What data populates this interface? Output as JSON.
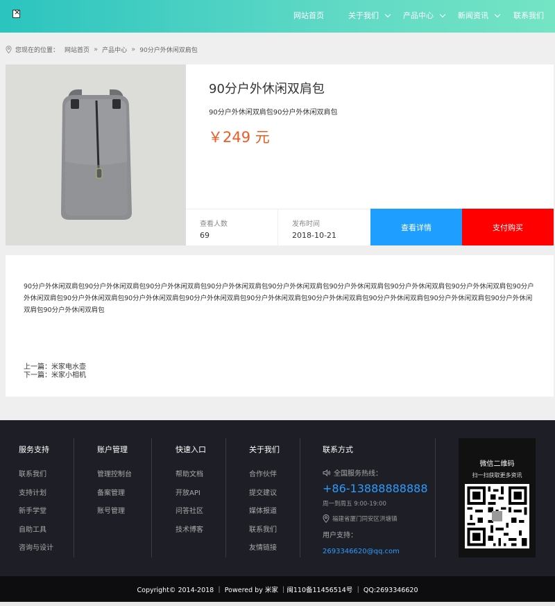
{
  "nav": {
    "items": [
      {
        "label": "网站首页",
        "dropdown": false
      },
      {
        "label": "关于我们",
        "dropdown": true
      },
      {
        "label": "产品中心",
        "dropdown": true
      },
      {
        "label": "新闻资讯",
        "dropdown": true
      },
      {
        "label": "联系我们",
        "dropdown": false
      }
    ]
  },
  "breadcrumb": {
    "prefix": "您现在的位置：",
    "items": [
      "网站首页",
      "产品中心",
      "90分户外休闲双肩包"
    ]
  },
  "product": {
    "title": "90分户外休闲双肩包",
    "subtitle": "90分户外休闲双肩包90分户外休闲双肩包",
    "price": "￥249 元",
    "views_label": "查看人数",
    "views_value": "69",
    "date_label": "发布时间",
    "date_value": "2018-10-21",
    "detail_button": "查看详情",
    "buy_button": "支付购买"
  },
  "description": {
    "text": "90分户外休闲双肩包90分户外休闲双肩包90分户外休闲双肩包90分户外休闲双肩包90分户外休闲双肩包90分户外休闲双肩包90分户外休闲双肩包90分户外休闲双肩包90分户外休闲双肩包90分户外休闲双肩包90分户外休闲双肩包90分户外休闲双肩包90分户外休闲双肩包90分户外休闲双肩包90分户外休闲双肩包90分户外休闲双肩包90分户外休闲双肩包90分户外休闲双肩包",
    "prev": "上一篇：米家电水壶",
    "next": "下一篇：米家小相机"
  },
  "footer": {
    "columns": [
      {
        "title": "服务支持",
        "items": [
          "联系我们",
          "支持计划",
          "新手学堂",
          "自助工具",
          "咨询与设计"
        ]
      },
      {
        "title": "账户管理",
        "items": [
          "管理控制台",
          "备案管理",
          "账号管理"
        ]
      },
      {
        "title": "快速入口",
        "items": [
          "帮助文档",
          "开放API",
          "问答社区",
          "技术博客"
        ]
      },
      {
        "title": "关于我们",
        "items": [
          "合作伙伴",
          "提交建议",
          "媒体报道",
          "联系我们",
          "友情链接"
        ]
      }
    ],
    "contact": {
      "title": "联系方式",
      "hotline_label": "全国服务热线：",
      "hotline": "+86-13888888888",
      "hours": "周一到周五 9:00-19:00",
      "address": "福建省厦门同安区洪塘镇",
      "support_label": "用户支持：",
      "email": "2693346620@qq.com"
    },
    "qr": {
      "title": "微信二维码",
      "subtitle": "扫一扫获取更多资讯"
    },
    "copyright": "Copyright© 2014-2018 ｜ Powered by 米家 ｜闽110备11456514号 ｜ QQ:2693346620"
  },
  "colors": {
    "accent_blue": "#1e9eff",
    "buy_red": "#ff0000",
    "price_orange": "#f05a22",
    "header_gradient_start": "#2bc4bf",
    "header_gradient_end": "#74e4c4"
  }
}
